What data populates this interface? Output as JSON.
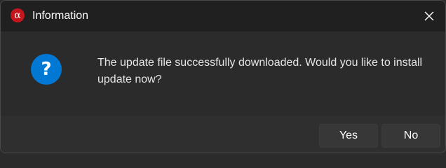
{
  "window": {
    "title": "Information",
    "app_icon_glyph": "α",
    "app_icon_color": "#c4161c",
    "close_icon": "close-icon"
  },
  "dialog": {
    "icon": "question-icon",
    "icon_glyph": "?",
    "icon_color": "#0078d4",
    "message": "The update file successfully downloaded. Would you like to install update now?"
  },
  "buttons": {
    "yes_label": "Yes",
    "no_label": "No"
  }
}
